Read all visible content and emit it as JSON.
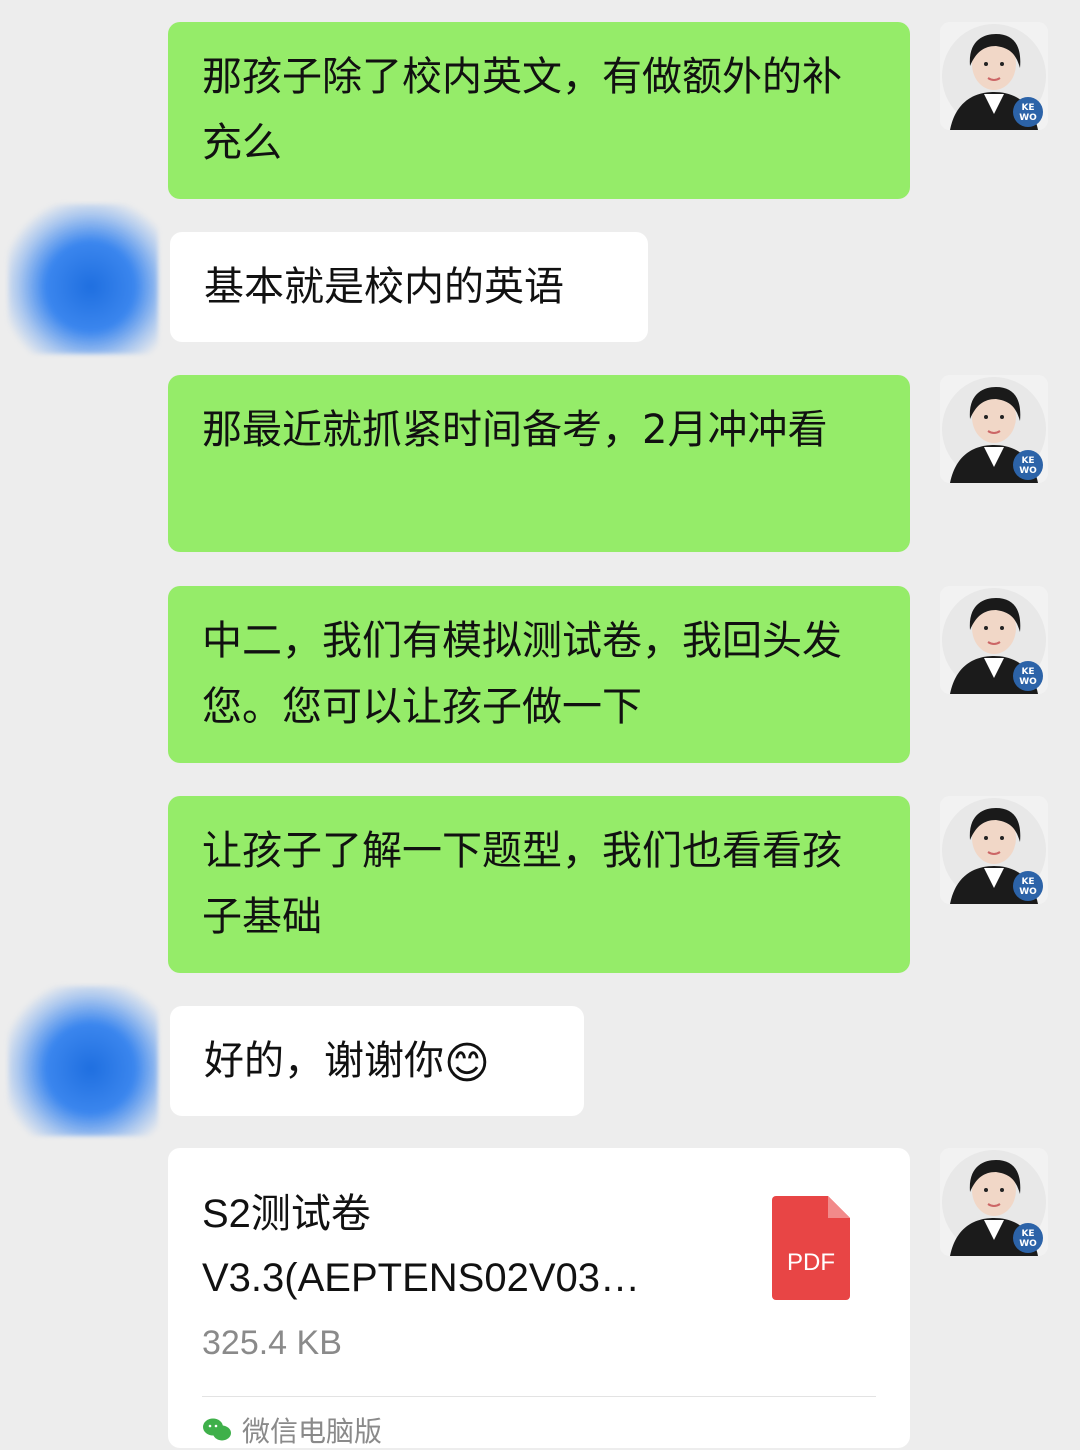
{
  "messages": [
    {
      "text": "那孩子除了校内英文，有做额外的补充么"
    },
    {
      "text": "基本就是校内的英语"
    },
    {
      "text": "那最近就抓紧时间备考，2月冲冲看"
    },
    {
      "text": "中二，我们有模拟测试卷，我回头发您。您可以让孩子做一下"
    },
    {
      "text": "让孩子了解一下题型，我们也看看孩子基础"
    },
    {
      "text": "好的，谢谢你",
      "emoji": "😊"
    }
  ],
  "file": {
    "name": "S2测试卷V3.3(AEPTENS02V03…",
    "size": "325.4 KB",
    "type_label": "PDF",
    "source": "微信电脑版"
  },
  "avatar": {
    "badge": "KE WO"
  },
  "colors": {
    "background": "#ededed",
    "sent_bubble": "#95ec69",
    "received_bubble": "#ffffff",
    "pdf_red": "#e84545",
    "badge_blue": "#2c63a8"
  }
}
